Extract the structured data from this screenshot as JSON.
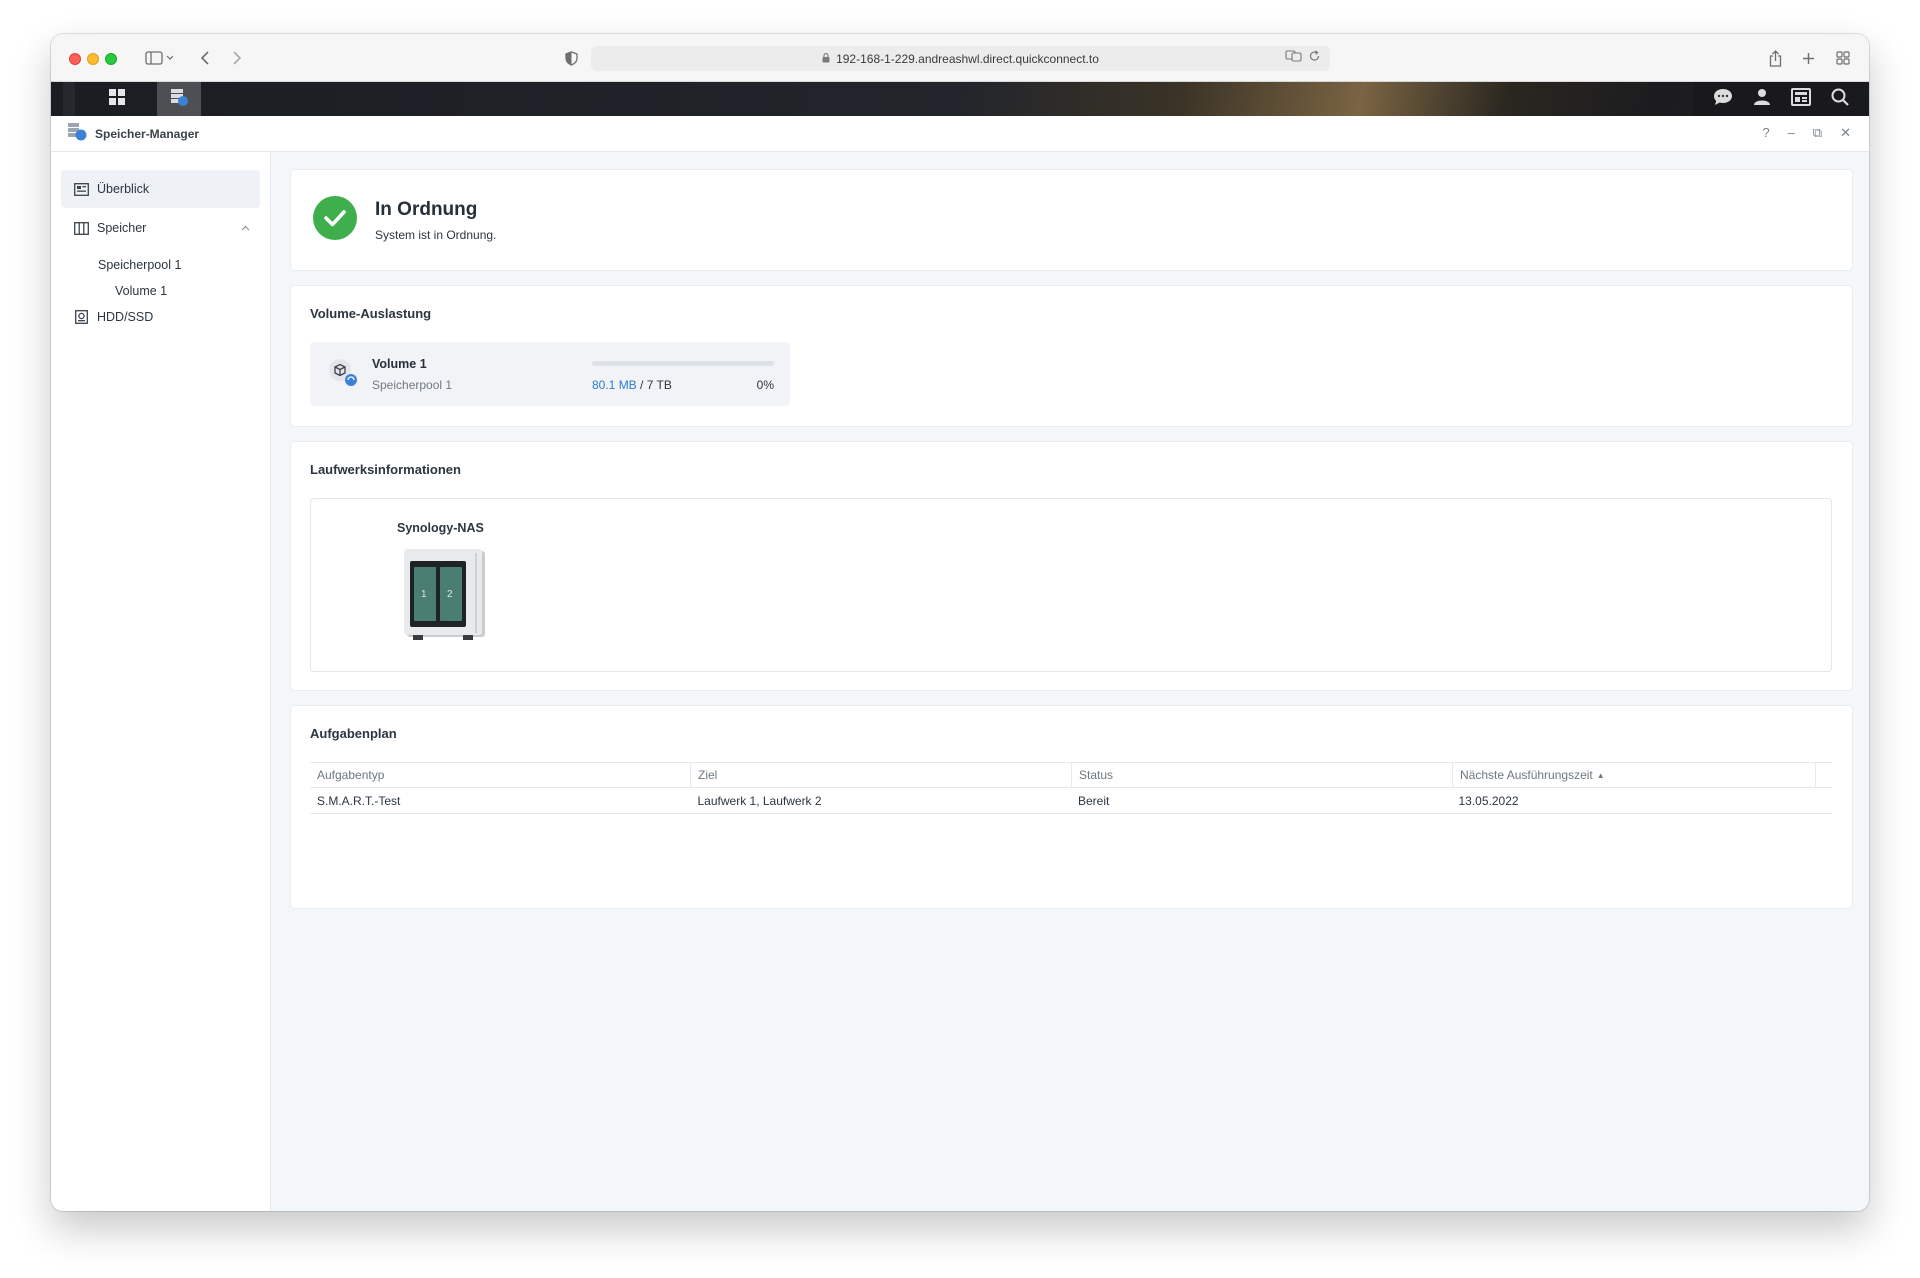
{
  "browser": {
    "url": "192-168-1-229.andreashwl.direct.quickconnect.to"
  },
  "app": {
    "title": "Speicher-Manager",
    "controls": [
      "?",
      "–",
      "⧉",
      "✕"
    ]
  },
  "sidebar": {
    "items": [
      {
        "label": "Überblick",
        "icon": "overview-icon",
        "selected": true
      },
      {
        "label": "Speicher",
        "icon": "storage-icon",
        "expanded": true
      },
      {
        "label": "HDD/SSD",
        "icon": "disk-icon"
      }
    ],
    "sub": {
      "pool": "Speicherpool 1",
      "volume": "Volume 1"
    }
  },
  "status": {
    "title": "In Ordnung",
    "subtitle": "System ist in Ordnung.",
    "color": "#3fae4c"
  },
  "volume_usage": {
    "heading": "Volume-Auslastung",
    "name": "Volume 1",
    "pool": "Speicherpool 1",
    "used": "80.1 MB",
    "total": " / 7 TB",
    "percent_label": "0%",
    "percent": 0
  },
  "drive_info": {
    "heading": "Laufwerksinformationen",
    "device": "Synology-NAS",
    "bays": [
      "1",
      "2"
    ]
  },
  "schedule": {
    "heading": "Aufgabenplan",
    "columns": [
      "Aufgabentyp",
      "Ziel",
      "Status",
      "Nächste Ausführungszeit"
    ],
    "rows": [
      {
        "type": "S.M.A.R.T.-Test",
        "target": "Laufwerk 1, Laufwerk 2",
        "status": "Bereit",
        "next": "13.05.2022"
      }
    ]
  }
}
